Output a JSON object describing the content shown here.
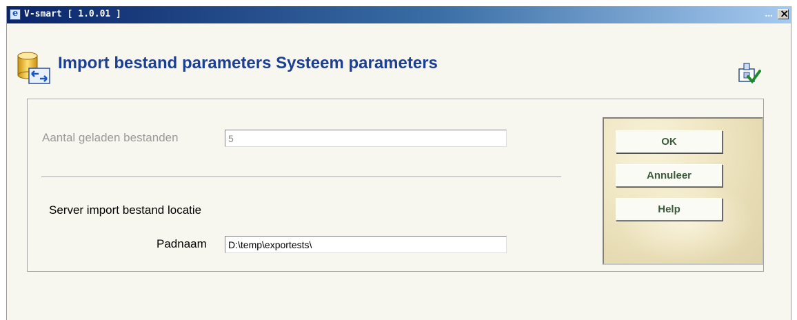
{
  "window": {
    "title": "V-smart [ 1.0.01 ]",
    "title_dots": "..."
  },
  "header": {
    "title": "Import bestand parameters Systeem parameters"
  },
  "form": {
    "loaded_files_label": "Aantal geladen bestanden",
    "loaded_files_value": "5",
    "section_label": "Server import bestand locatie",
    "path_label": "Padnaam",
    "path_value": "D:\\temp\\exportests\\"
  },
  "buttons": {
    "ok": "OK",
    "cancel": "Annuleer",
    "help": "Help"
  },
  "icons": {
    "app": "ie-icon",
    "header": "database-import-icon",
    "corner": "settings-check-icon",
    "close": "close-icon"
  },
  "colors": {
    "title_text": "#1c3f93",
    "button_text": "#3a5a3a",
    "titlebar": "#0a246a"
  }
}
